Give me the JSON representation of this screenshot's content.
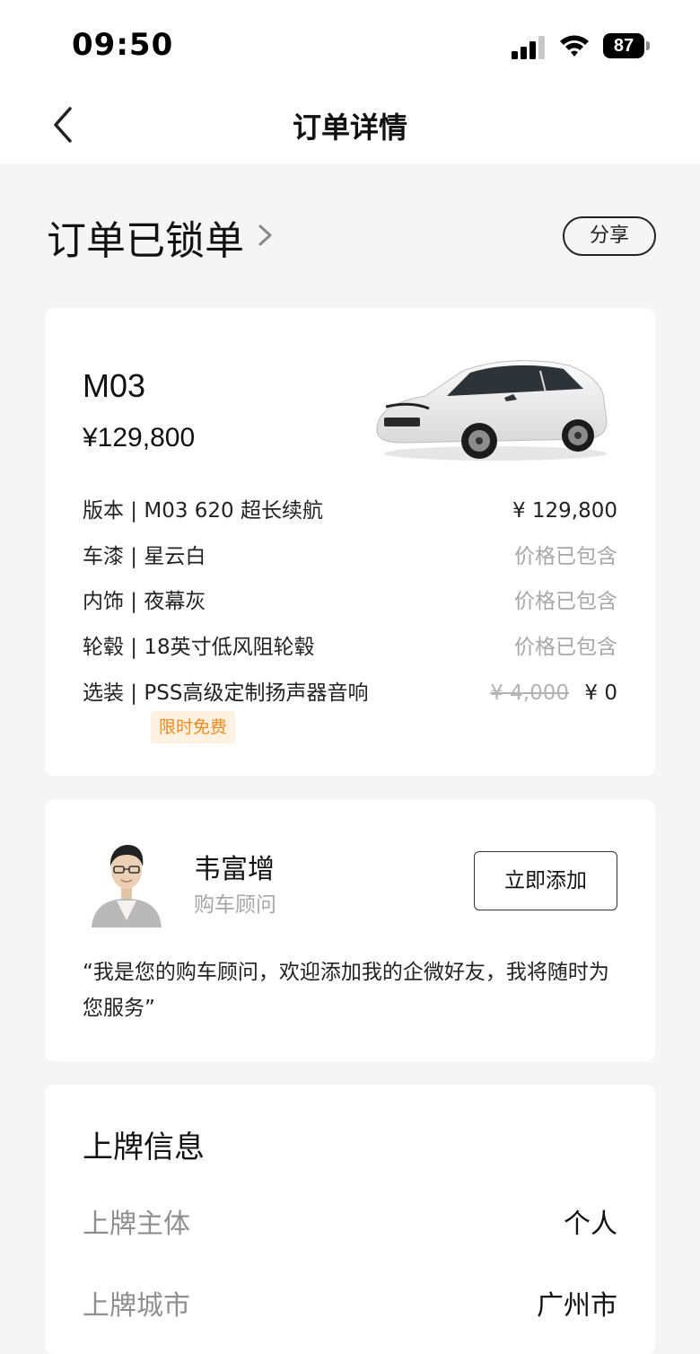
{
  "status_bar": {
    "time": "09:50",
    "battery": "87"
  },
  "nav": {
    "title": "订单详情"
  },
  "order": {
    "status": "订单已锁单",
    "share_label": "分享"
  },
  "car": {
    "model": "M03",
    "price": "¥129,800",
    "specs": [
      {
        "label": "版本 | M03 620 超长续航",
        "value": "¥ 129,800"
      },
      {
        "label": "车漆 | 星云白",
        "value": "价格已包含"
      },
      {
        "label": "内饰 | 夜幕灰",
        "value": "价格已包含"
      },
      {
        "label": "轮毂 | 18英寸低风阻轮毂",
        "value": "价格已包含"
      },
      {
        "label": "选装 | PSS高级定制扬声器音响",
        "original_price": "¥ 4,000",
        "value": "¥ 0",
        "tag": "限时免费"
      }
    ]
  },
  "advisor": {
    "name": "韦富增",
    "role": "购车顾问",
    "add_label": "立即添加",
    "quote": "“我是您的购车顾问，欢迎添加我的企微好友，我将随时为您服务”"
  },
  "plate": {
    "title": "上牌信息",
    "rows": [
      {
        "label": "上牌主体",
        "value": "个人"
      },
      {
        "label": "上牌城市",
        "value": "广州市"
      }
    ]
  }
}
